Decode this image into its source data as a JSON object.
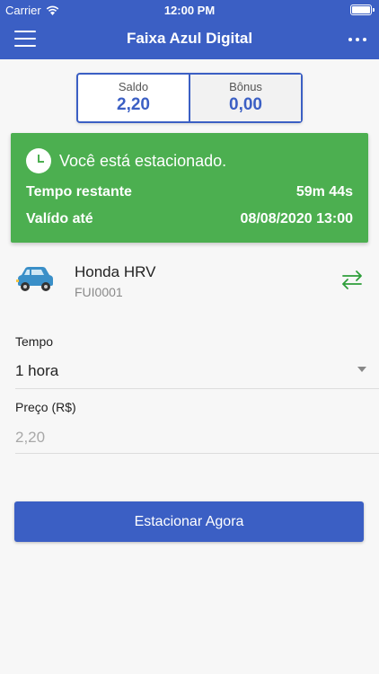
{
  "status_bar": {
    "carrier": "Carrier",
    "time": "12:00 PM"
  },
  "nav": {
    "title": "Faixa Azul Digital"
  },
  "balance": {
    "saldo_label": "Saldo",
    "saldo_value": "2,20",
    "bonus_label": "Bônus",
    "bonus_value": "0,00"
  },
  "parked": {
    "message": "Você está estacionado.",
    "remaining_label": "Tempo restante",
    "remaining_value": "59m 44s",
    "valid_label": "Valído até",
    "valid_value": "08/08/2020 13:00"
  },
  "vehicle": {
    "name": "Honda HRV",
    "plate": "FUI0001"
  },
  "form": {
    "tempo_label": "Tempo",
    "tempo_value": "1 hora",
    "price_label": "Preço (R$)",
    "price_value": "2,20"
  },
  "action": {
    "park_label": "Estacionar Agora"
  },
  "colors": {
    "primary": "#3b5fc4",
    "success": "#4caf50",
    "swap_icon": "#2e9e3a"
  }
}
